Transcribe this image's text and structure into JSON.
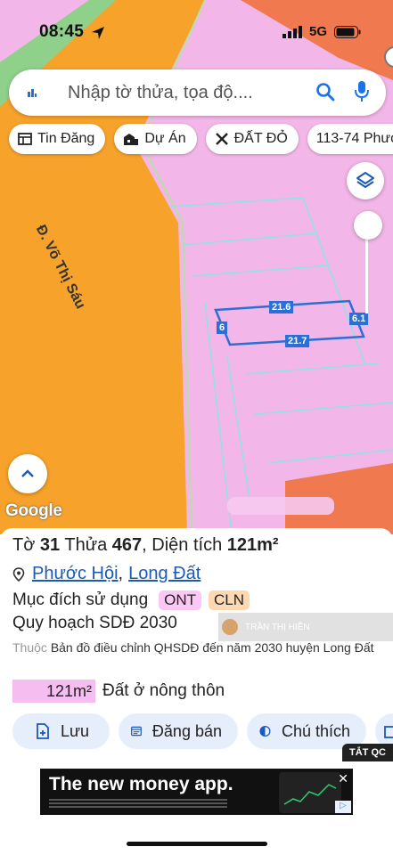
{
  "status_bar": {
    "time": "08:45",
    "network": "5G"
  },
  "search": {
    "placeholder": "Nhập tờ thửa, tọa độ...."
  },
  "chips": [
    {
      "label": "Tin Đăng",
      "icon": "newspaper-icon"
    },
    {
      "label": "Dự Án",
      "icon": "buildings-icon"
    },
    {
      "label": "ĐẤT ĐỎ",
      "icon": "tools-icon"
    },
    {
      "label": "113-74 Phướ",
      "icon": "none"
    }
  ],
  "map": {
    "road_label": "Đ. Võ Thị Sáu",
    "dimensions": {
      "top": "21.6",
      "bottom": "21.7",
      "left": "6",
      "right": "6.1"
    },
    "logo": "Google",
    "colors": {
      "road": "#f7a22a",
      "residential": "#f3b6e8",
      "forest": "#8fd08a",
      "parcel_line": "#8fe3e8",
      "highlight": "#2a6fd6",
      "orange_zone": "#f0794f"
    }
  },
  "info": {
    "to_label": "Tờ",
    "to_value": "31",
    "thua_label": "Thửa",
    "thua_value": "467",
    "area_label": ", Diện tích",
    "area_value": "121m²",
    "ward": "Phước Hội",
    "separator": ",",
    "district": "Long Đất",
    "usage_label": "Mục đích sử dụng",
    "usage_tags": [
      "ONT",
      "CLN"
    ],
    "plan_label": "Quy hoạch SDĐ 2030",
    "watermark_name": "TRẦN THỊ HIỀN",
    "note_prefix": "Thuộc",
    "note_text": "Bản đồ điều chỉnh QHSDĐ đến năm 2030 huyện Long Đất",
    "area_box_value": "121m²",
    "land_type": "Đất ở nông thôn"
  },
  "actions": [
    {
      "label": "Lưu",
      "icon": "save-icon"
    },
    {
      "label": "Đăng bán",
      "icon": "listing-icon"
    },
    {
      "label": "Chú thích",
      "icon": "legend-icon"
    }
  ],
  "ad": {
    "label": "TẮT QC",
    "headline": "The new money app."
  }
}
